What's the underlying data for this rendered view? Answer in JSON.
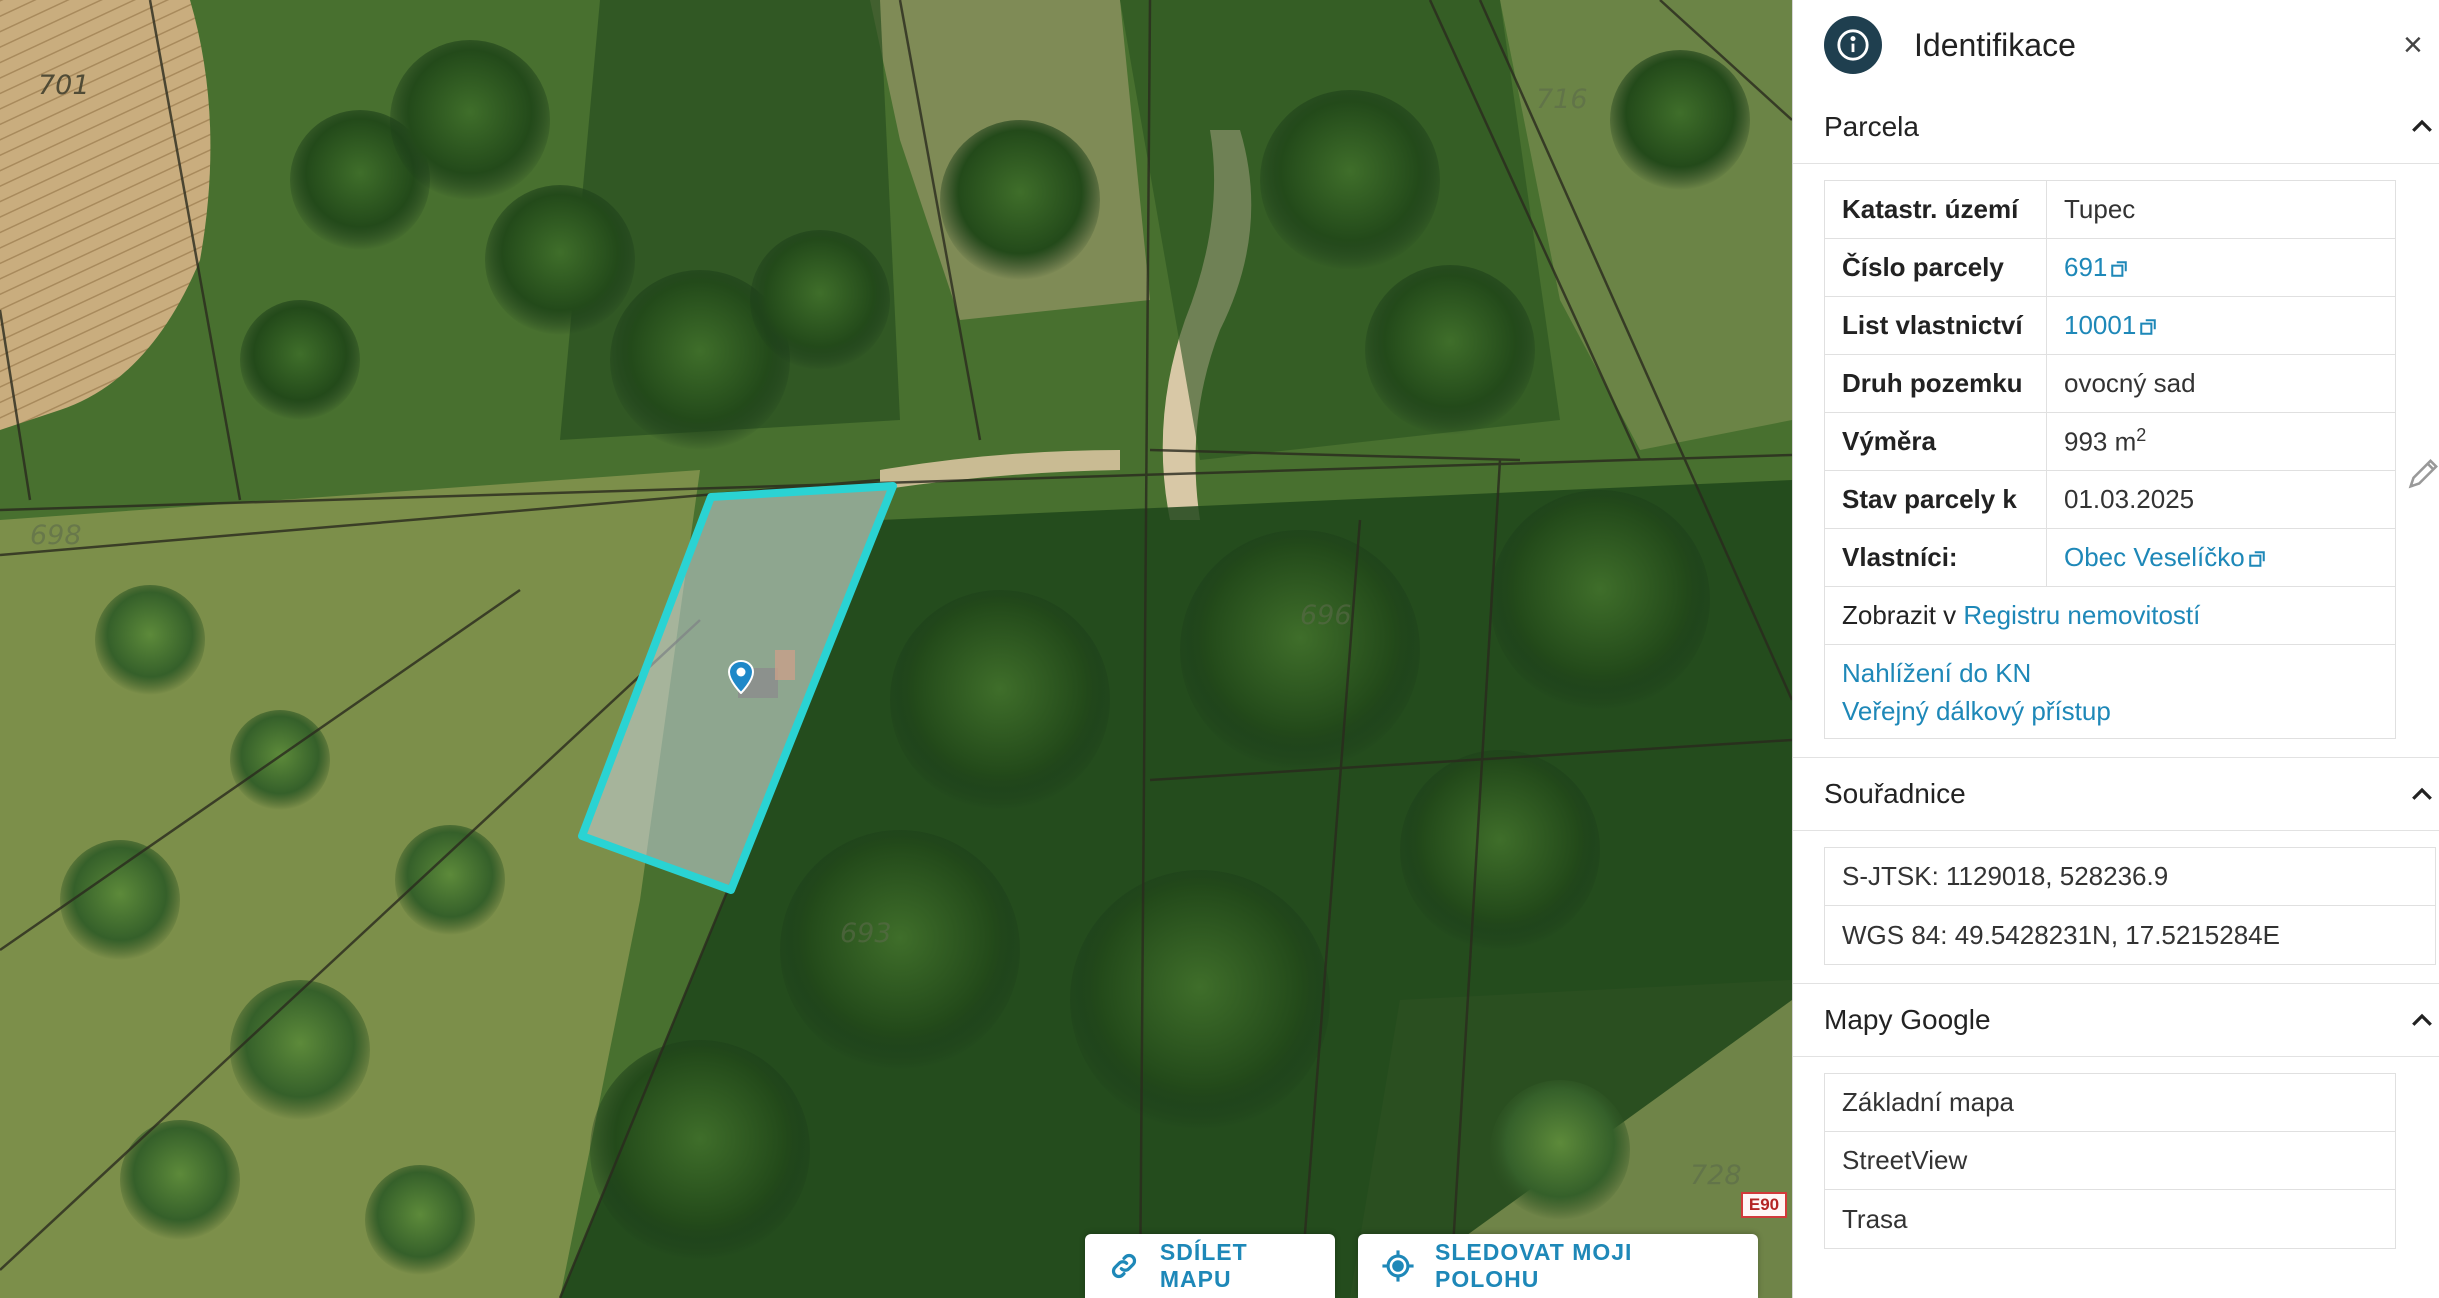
{
  "map": {
    "parcel_labels": [
      "701",
      "698",
      "716",
      "696",
      "693",
      "728"
    ],
    "share_button": {
      "label": "SDÍLET MAPU",
      "icon": "link-icon"
    },
    "track_button": {
      "label": "SLEDOVAT MOJI POLOHU",
      "icon": "locate-icon"
    },
    "road_badge": "E90",
    "highlight_color": "#2ad3d3"
  },
  "panel": {
    "title": "Identifikace",
    "icon": "info-icon",
    "close": "×",
    "parcela": {
      "heading": "Parcela",
      "rows": [
        {
          "key": "Katastr. území",
          "value": "Tupec"
        },
        {
          "key": "Číslo parcely",
          "value": "691"
        },
        {
          "key": "List vlastnictví",
          "value": "10001"
        },
        {
          "key": "Druh pozemku",
          "value": "ovocný sad"
        },
        {
          "key": "Výměra",
          "value": "993 m",
          "sup": "2"
        },
        {
          "key": "Stav parcely k",
          "value": "01.03.2025"
        },
        {
          "key": "Vlastníci:",
          "value": "Obec Veselíčko"
        }
      ],
      "show_in_prefix": "Zobrazit v ",
      "show_in_link": "Registru nemovitostí",
      "link_kn": "Nahlížení do KN",
      "link_remote": "Veřejný dálkový přístup"
    },
    "souradnice": {
      "heading": "Souřadnice",
      "sjtsk": "S-JTSK: 1129018, 528236.9",
      "wgs": "WGS 84: 49.5428231N, 17.5215284E"
    },
    "google": {
      "heading": "Mapy Google",
      "links": [
        "Základní mapa",
        "StreetView",
        "Trasa"
      ]
    }
  }
}
